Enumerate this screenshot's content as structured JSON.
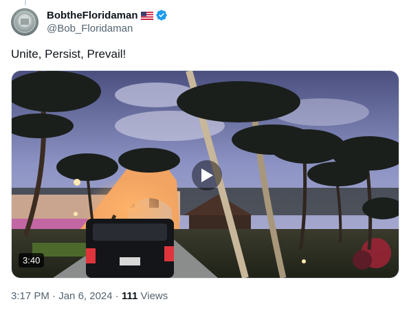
{
  "author": {
    "display_name": "BobtheFloridaman",
    "handle": "@Bob_Floridaman",
    "verified": true
  },
  "tweet": {
    "text": "Unite, Persist, Prevail!"
  },
  "video": {
    "duration": "3:40"
  },
  "meta": {
    "time": "3:17 PM",
    "date": "Jan 6, 2024",
    "separator": " · ",
    "views_count": "111",
    "views_label": " Views"
  },
  "colors": {
    "verified": "#1d9bf0",
    "secondary_text": "#536471"
  },
  "icons": {
    "flag": "us-flag-icon",
    "verified": "verified-badge-icon",
    "play": "play-icon"
  }
}
